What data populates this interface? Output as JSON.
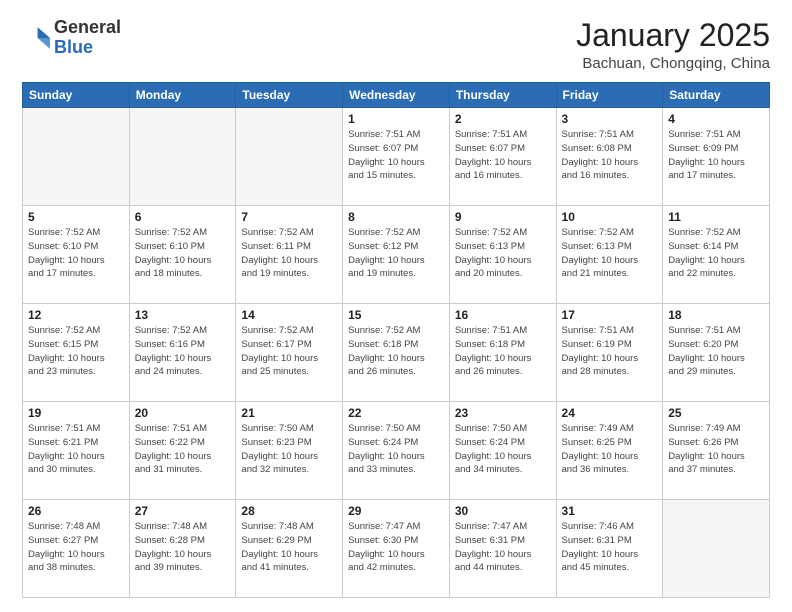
{
  "header": {
    "logo_general": "General",
    "logo_blue": "Blue",
    "month_title": "January 2025",
    "location": "Bachuan, Chongqing, China"
  },
  "weekdays": [
    "Sunday",
    "Monday",
    "Tuesday",
    "Wednesday",
    "Thursday",
    "Friday",
    "Saturday"
  ],
  "weeks": [
    [
      {
        "day": "",
        "info": ""
      },
      {
        "day": "",
        "info": ""
      },
      {
        "day": "",
        "info": ""
      },
      {
        "day": "1",
        "info": "Sunrise: 7:51 AM\nSunset: 6:07 PM\nDaylight: 10 hours\nand 15 minutes."
      },
      {
        "day": "2",
        "info": "Sunrise: 7:51 AM\nSunset: 6:07 PM\nDaylight: 10 hours\nand 16 minutes."
      },
      {
        "day": "3",
        "info": "Sunrise: 7:51 AM\nSunset: 6:08 PM\nDaylight: 10 hours\nand 16 minutes."
      },
      {
        "day": "4",
        "info": "Sunrise: 7:51 AM\nSunset: 6:09 PM\nDaylight: 10 hours\nand 17 minutes."
      }
    ],
    [
      {
        "day": "5",
        "info": "Sunrise: 7:52 AM\nSunset: 6:10 PM\nDaylight: 10 hours\nand 17 minutes."
      },
      {
        "day": "6",
        "info": "Sunrise: 7:52 AM\nSunset: 6:10 PM\nDaylight: 10 hours\nand 18 minutes."
      },
      {
        "day": "7",
        "info": "Sunrise: 7:52 AM\nSunset: 6:11 PM\nDaylight: 10 hours\nand 19 minutes."
      },
      {
        "day": "8",
        "info": "Sunrise: 7:52 AM\nSunset: 6:12 PM\nDaylight: 10 hours\nand 19 minutes."
      },
      {
        "day": "9",
        "info": "Sunrise: 7:52 AM\nSunset: 6:13 PM\nDaylight: 10 hours\nand 20 minutes."
      },
      {
        "day": "10",
        "info": "Sunrise: 7:52 AM\nSunset: 6:13 PM\nDaylight: 10 hours\nand 21 minutes."
      },
      {
        "day": "11",
        "info": "Sunrise: 7:52 AM\nSunset: 6:14 PM\nDaylight: 10 hours\nand 22 minutes."
      }
    ],
    [
      {
        "day": "12",
        "info": "Sunrise: 7:52 AM\nSunset: 6:15 PM\nDaylight: 10 hours\nand 23 minutes."
      },
      {
        "day": "13",
        "info": "Sunrise: 7:52 AM\nSunset: 6:16 PM\nDaylight: 10 hours\nand 24 minutes."
      },
      {
        "day": "14",
        "info": "Sunrise: 7:52 AM\nSunset: 6:17 PM\nDaylight: 10 hours\nand 25 minutes."
      },
      {
        "day": "15",
        "info": "Sunrise: 7:52 AM\nSunset: 6:18 PM\nDaylight: 10 hours\nand 26 minutes."
      },
      {
        "day": "16",
        "info": "Sunrise: 7:51 AM\nSunset: 6:18 PM\nDaylight: 10 hours\nand 26 minutes."
      },
      {
        "day": "17",
        "info": "Sunrise: 7:51 AM\nSunset: 6:19 PM\nDaylight: 10 hours\nand 28 minutes."
      },
      {
        "day": "18",
        "info": "Sunrise: 7:51 AM\nSunset: 6:20 PM\nDaylight: 10 hours\nand 29 minutes."
      }
    ],
    [
      {
        "day": "19",
        "info": "Sunrise: 7:51 AM\nSunset: 6:21 PM\nDaylight: 10 hours\nand 30 minutes."
      },
      {
        "day": "20",
        "info": "Sunrise: 7:51 AM\nSunset: 6:22 PM\nDaylight: 10 hours\nand 31 minutes."
      },
      {
        "day": "21",
        "info": "Sunrise: 7:50 AM\nSunset: 6:23 PM\nDaylight: 10 hours\nand 32 minutes."
      },
      {
        "day": "22",
        "info": "Sunrise: 7:50 AM\nSunset: 6:24 PM\nDaylight: 10 hours\nand 33 minutes."
      },
      {
        "day": "23",
        "info": "Sunrise: 7:50 AM\nSunset: 6:24 PM\nDaylight: 10 hours\nand 34 minutes."
      },
      {
        "day": "24",
        "info": "Sunrise: 7:49 AM\nSunset: 6:25 PM\nDaylight: 10 hours\nand 36 minutes."
      },
      {
        "day": "25",
        "info": "Sunrise: 7:49 AM\nSunset: 6:26 PM\nDaylight: 10 hours\nand 37 minutes."
      }
    ],
    [
      {
        "day": "26",
        "info": "Sunrise: 7:48 AM\nSunset: 6:27 PM\nDaylight: 10 hours\nand 38 minutes."
      },
      {
        "day": "27",
        "info": "Sunrise: 7:48 AM\nSunset: 6:28 PM\nDaylight: 10 hours\nand 39 minutes."
      },
      {
        "day": "28",
        "info": "Sunrise: 7:48 AM\nSunset: 6:29 PM\nDaylight: 10 hours\nand 41 minutes."
      },
      {
        "day": "29",
        "info": "Sunrise: 7:47 AM\nSunset: 6:30 PM\nDaylight: 10 hours\nand 42 minutes."
      },
      {
        "day": "30",
        "info": "Sunrise: 7:47 AM\nSunset: 6:31 PM\nDaylight: 10 hours\nand 44 minutes."
      },
      {
        "day": "31",
        "info": "Sunrise: 7:46 AM\nSunset: 6:31 PM\nDaylight: 10 hours\nand 45 minutes."
      },
      {
        "day": "",
        "info": ""
      }
    ]
  ]
}
